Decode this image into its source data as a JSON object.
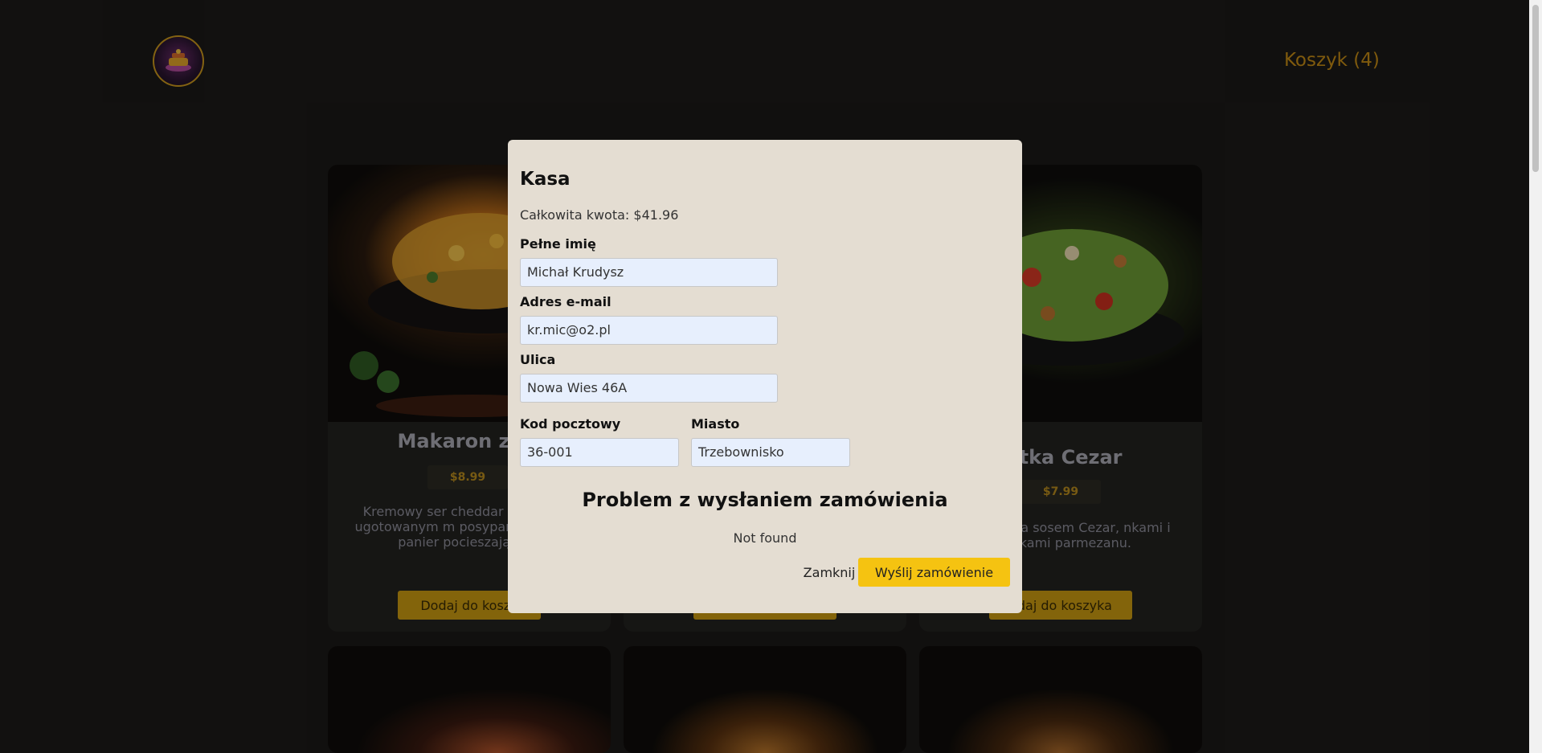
{
  "header": {
    "logo_icon": "restaurant-logo-icon",
    "cart_label": "Koszyk (4)"
  },
  "products": [
    {
      "title": "Makaron z se",
      "price": "$8.99",
      "description": "Kremowy ser cheddar wy idealnie ugotowanym m posypany chrupiącą panier pocieszające da",
      "button": "Dodaj do koszy"
    },
    {
      "title": "",
      "price": "",
      "description": "",
      "button": ""
    },
    {
      "title": "łatka Cezar",
      "price": "$7.99",
      "description": "iska polana sosem Cezar, nkami i płatkami parmezanu.",
      "button": "odaj do koszyka"
    }
  ],
  "modal": {
    "title": "Kasa",
    "total": "Całkowita kwota: $41.96",
    "fields": {
      "name_label": "Pełne imię",
      "name_value": "Michał Krudysz",
      "email_label": "Adres e-mail",
      "email_value": "kr.mic@o2.pl",
      "street_label": "Ulica",
      "street_value": "Nowa Wies 46A",
      "zip_label": "Kod pocztowy",
      "zip_value": "36-001",
      "city_label": "Miasto",
      "city_value": "Trzebownisko"
    },
    "error_title": "Problem z wysłaniem zamówienia",
    "error_message": "Not found",
    "close_label": "Zamknij",
    "submit_label": "Wyślij zamówienie"
  },
  "colors": {
    "background": "#1b1a18",
    "accent": "#c99a12",
    "modal_bg": "#e4ddd2",
    "submit": "#f5c311"
  }
}
